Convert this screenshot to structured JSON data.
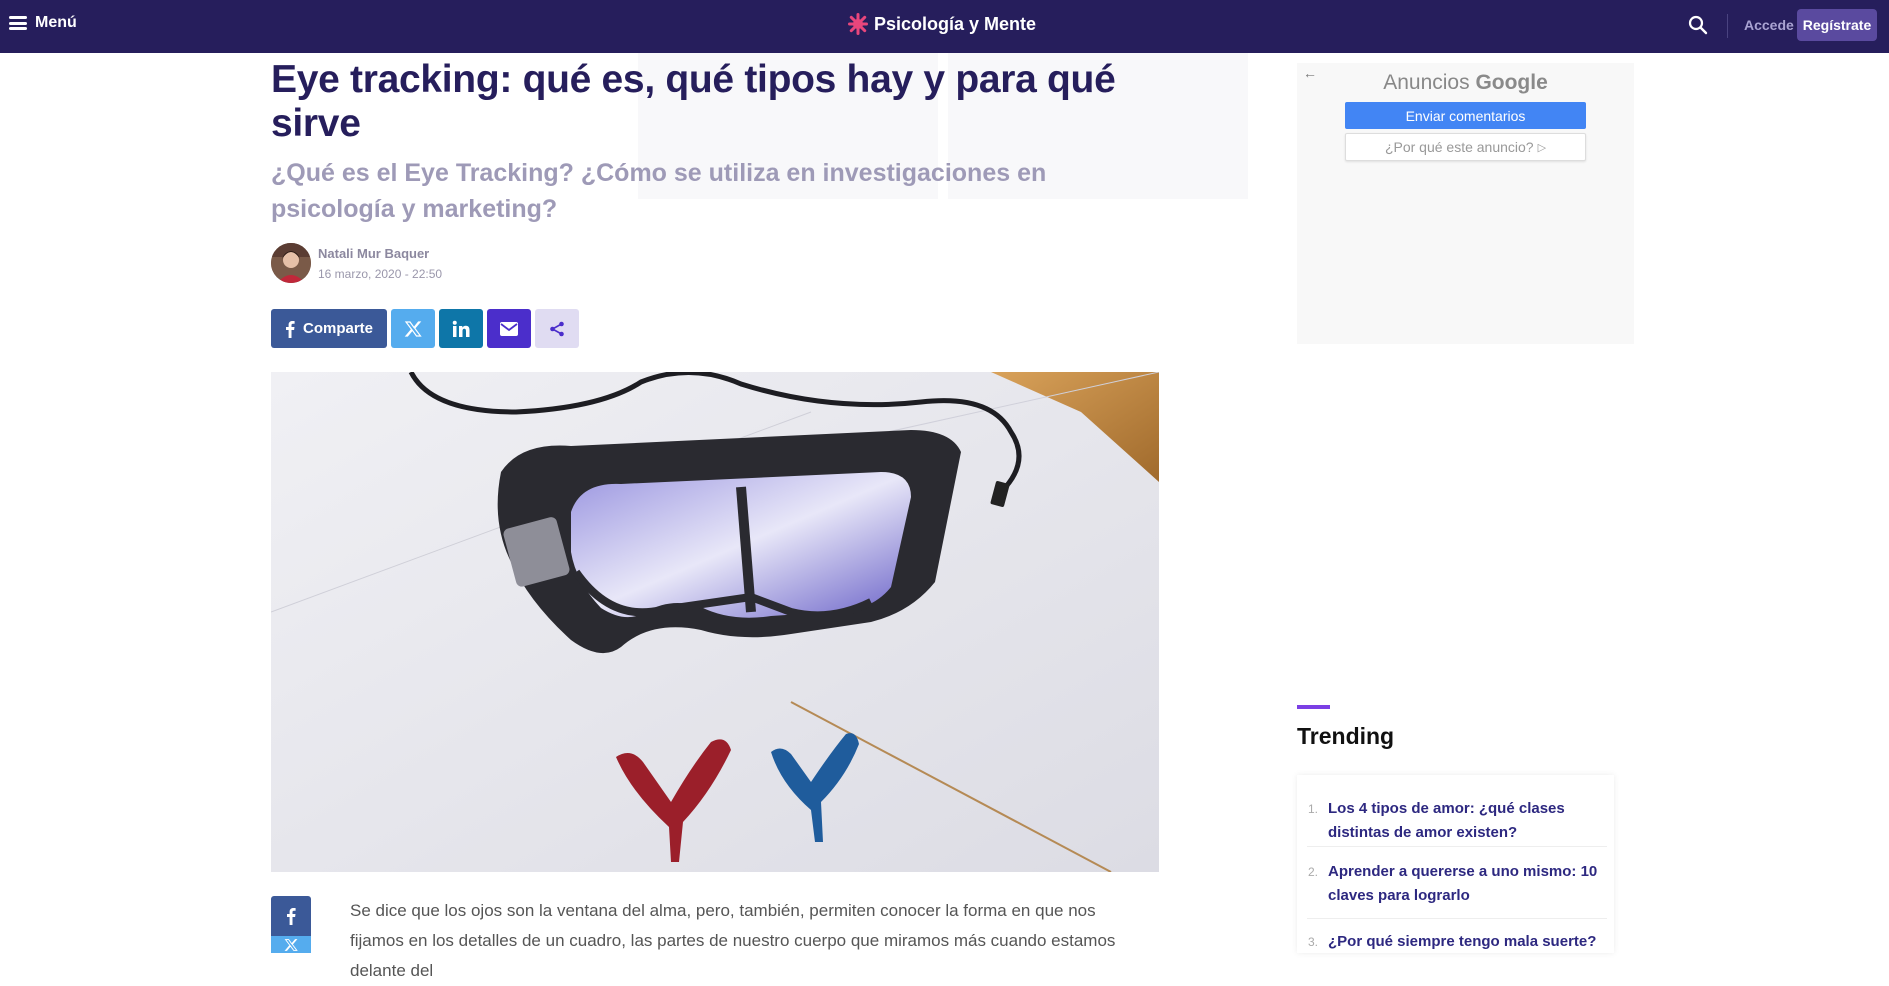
{
  "header": {
    "menu_label": "Menú",
    "logo_text": "Psicología y Mente",
    "login_label": "Accede",
    "register_label": "Regístrate",
    "background_color": "#261e5c"
  },
  "article": {
    "title": "Eye tracking: qué es, qué tipos hay y para qué sirve",
    "subtitle": "¿Qué es el Eye Tracking? ¿Cómo se utiliza en investigaciones en psicología y marketing?",
    "author": "Natali Mur Baquer",
    "date": "16 marzo, 2020 - 22:50",
    "body_first_paragraph": "Se dice que los ojos son la ventana del alma, pero, también, permiten conocer la forma en que nos fijamos en los detalles de un cuadro, las partes de nuestro cuerpo que miramos más cuando estamos delante del"
  },
  "share": {
    "facebook_label": "Comparte",
    "colors": {
      "facebook": "#3b5998",
      "x": "#55acee",
      "linkedin": "#0e76a8",
      "email": "#4b2ecb",
      "more": "#e0dcf2"
    }
  },
  "ad": {
    "title_prefix": "Anuncios",
    "title_brand": "Google",
    "feedback_button": "Enviar comentarios",
    "why_link": "¿Por qué este anuncio?"
  },
  "trending": {
    "heading": "Trending",
    "items": [
      {
        "number": "1.",
        "text": "Los 4 tipos de amor: ¿qué clases distintas de amor existen?"
      },
      {
        "number": "2.",
        "text": "Aprender a quererse a uno mismo: 10 claves para lograrlo"
      },
      {
        "number": "3.",
        "text": "¿Por qué siempre tengo mala suerte?"
      }
    ]
  }
}
